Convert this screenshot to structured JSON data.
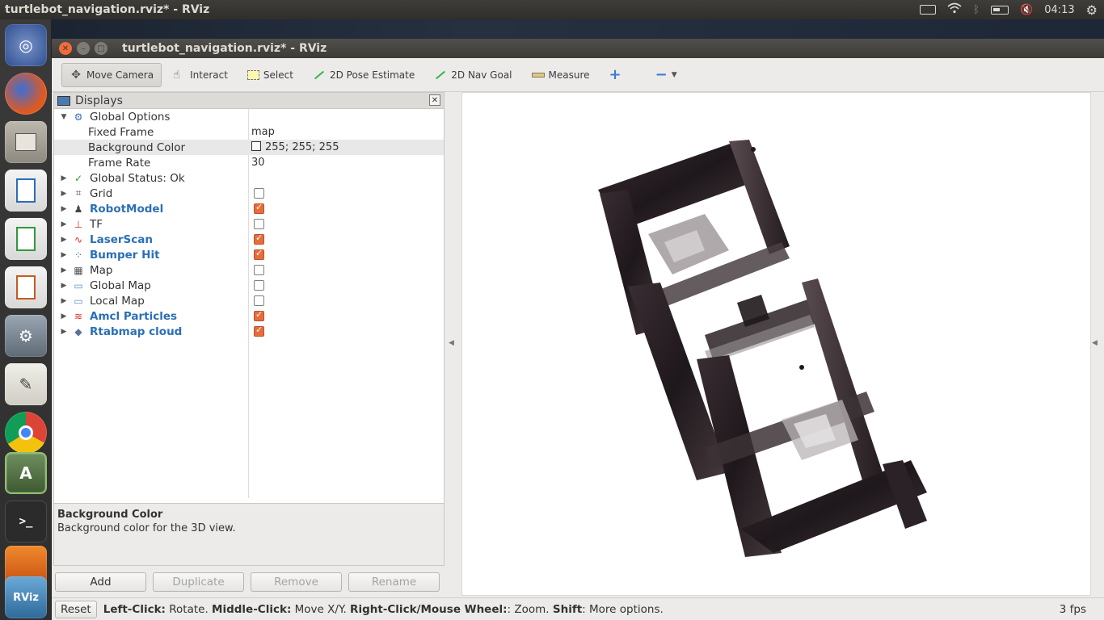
{
  "top_panel": {
    "title": "turtlebot_navigation.rviz* - RViz",
    "clock": "04:13"
  },
  "window": {
    "title": "turtlebot_navigation.rviz* - RViz"
  },
  "toolbar": {
    "move_camera": "Move Camera",
    "interact": "Interact",
    "select": "Select",
    "pose_estimate": "2D Pose Estimate",
    "nav_goal": "2D Nav Goal",
    "measure": "Measure"
  },
  "displays": {
    "header": "Displays",
    "global_options": "Global Options",
    "fixed_frame_label": "Fixed Frame",
    "fixed_frame_value": "map",
    "bg_color_label": "Background Color",
    "bg_color_value": "255; 255; 255",
    "frame_rate_label": "Frame Rate",
    "frame_rate_value": "30",
    "global_status": "Global Status: Ok",
    "items": [
      {
        "label": "Grid",
        "checked": false,
        "highlight": false
      },
      {
        "label": "RobotModel",
        "checked": true,
        "highlight": true
      },
      {
        "label": "TF",
        "checked": false,
        "highlight": false
      },
      {
        "label": "LaserScan",
        "checked": true,
        "highlight": true
      },
      {
        "label": "Bumper Hit",
        "checked": true,
        "highlight": true
      },
      {
        "label": "Map",
        "checked": false,
        "highlight": false
      },
      {
        "label": "Global Map",
        "checked": false,
        "highlight": false
      },
      {
        "label": "Local Map",
        "checked": false,
        "highlight": false
      },
      {
        "label": "Amcl Particles",
        "checked": true,
        "highlight": true
      },
      {
        "label": "Rtabmap cloud",
        "checked": true,
        "highlight": true
      }
    ]
  },
  "description": {
    "title": "Background Color",
    "text": "Background color for the 3D view."
  },
  "buttons": {
    "add": "Add",
    "duplicate": "Duplicate",
    "remove": "Remove",
    "rename": "Rename"
  },
  "statusbar": {
    "reset": "Reset",
    "hint_1b": "Left-Click:",
    "hint_1": " Rotate. ",
    "hint_2b": "Middle-Click:",
    "hint_2": " Move X/Y. ",
    "hint_3b": "Right-Click/Mouse Wheel:",
    "hint_3": ": Zoom. ",
    "hint_4b": "Shift",
    "hint_4": ": More options.",
    "fps": "3 fps"
  },
  "colors": {
    "checkbox_on": "#e86d3c",
    "highlight_text": "#2b6fb6",
    "panel_bg": "#ecebe9"
  }
}
